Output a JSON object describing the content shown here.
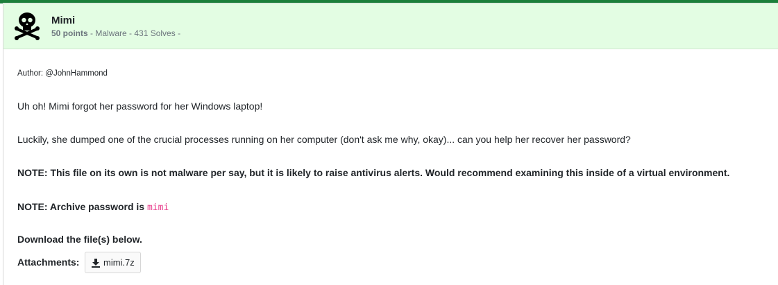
{
  "challenge": {
    "title": "Mimi",
    "points": "50 points",
    "meta_rest": " - Malware - 431 Solves -",
    "icon": "skull-crossbones-icon"
  },
  "description": {
    "author": "Author: @JohnHammond",
    "p1": "Uh oh! Mimi forgot her password for her Windows laptop!",
    "p2": "Luckily, she dumped one of the crucial processes running on her computer (don't ask me why, okay)... can you help her recover her password?",
    "p3": "NOTE: This file on its own is not malware per say, but it is likely to raise antivirus alerts. Would recommend examining this inside of a virtual environment.",
    "p4_prefix": "NOTE: Archive password is ",
    "p4_code": "mimi",
    "p5": "Download the file(s) below."
  },
  "attachments": {
    "label": "Attachments:",
    "file_name": "mimi.7z",
    "icon": "download-icon"
  },
  "colors": {
    "header_bg": "#e3fde3",
    "accent_bar": "#1b7f3a",
    "code_color": "#e83e8c"
  }
}
